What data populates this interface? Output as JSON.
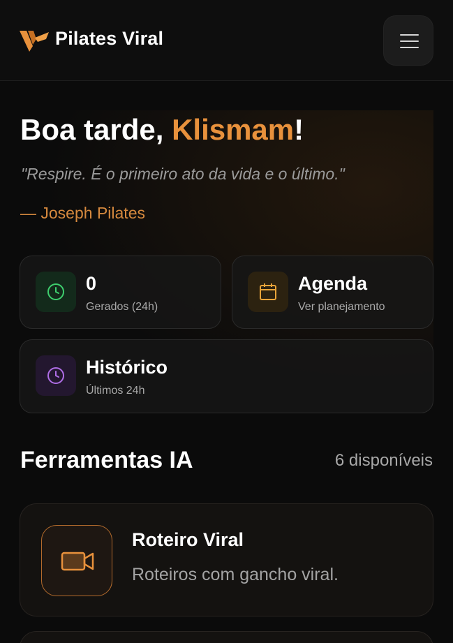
{
  "header": {
    "brand": "Pilates Viral",
    "logo_icon": "pilates-viral-logo",
    "menu_icon": "hamburger-icon"
  },
  "hero": {
    "greeting_prefix": "Boa tarde, ",
    "user_name": "Klismam",
    "greeting_suffix": "!",
    "quote": "\"Respire. É o primeiro ato da vida e o último.\"",
    "author": "— Joseph Pilates"
  },
  "stats": [
    {
      "value": "0",
      "label": "Gerados (24h)",
      "icon": "clock-icon",
      "color": "#3ecf6e"
    },
    {
      "value": "Agenda",
      "label": "Ver planejamento",
      "icon": "calendar-icon",
      "color": "#e8a43a"
    },
    {
      "value": "Histórico",
      "label": "Últimos 24h",
      "icon": "clock-icon",
      "color": "#b06ee8"
    }
  ],
  "tools": {
    "title": "Ferramentas IA",
    "count": "6 disponíveis",
    "items": [
      {
        "title": "Roteiro Viral",
        "description": "Roteiros com gancho viral.",
        "icon": "video-camera-icon"
      }
    ]
  },
  "colors": {
    "accent": "#e8913c",
    "background": "#0b0b0b"
  }
}
